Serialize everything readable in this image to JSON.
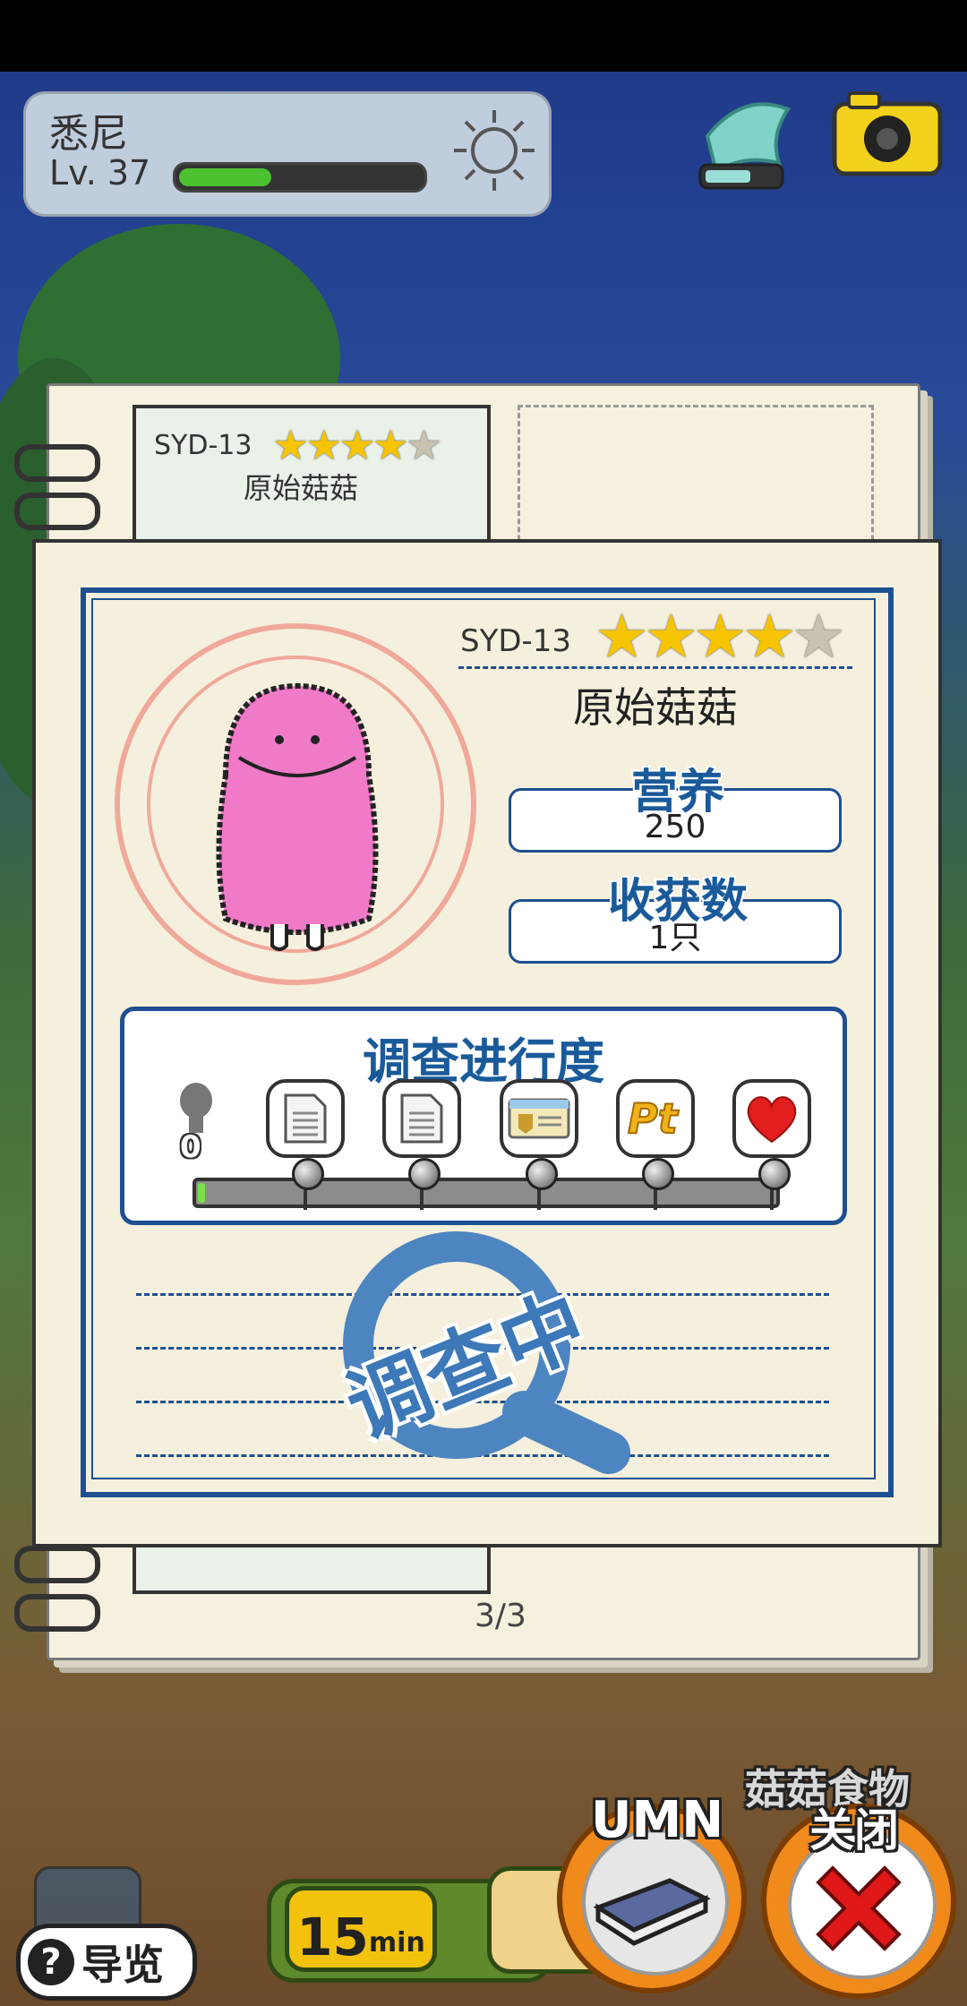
{
  "player": {
    "name": "悉尼",
    "level": "Lv. 37",
    "xp_fraction": 0.38
  },
  "book": {
    "page_indicator": "3/3",
    "left_card": {
      "code": "SYD-13",
      "name": "原始菇菇",
      "stars": 4,
      "max_stars": 5
    }
  },
  "detail": {
    "code": "SYD-13",
    "stars": 4,
    "max_stars": 5,
    "name": "原始菇菇",
    "nutrition_label": "营养",
    "nutrition_value": "250",
    "harvest_label": "收获数",
    "harvest_value": "1只",
    "progress_title": "调查进行度",
    "progress_count": "0",
    "progress_fraction": 0.01,
    "milestones": [
      "document-icon",
      "document-icon",
      "id-card-icon",
      "pt-icon",
      "heart-icon"
    ],
    "stamp_text": "调查中"
  },
  "bottom": {
    "timer_value": "15",
    "timer_unit": "min",
    "mushroom_food_label": "菇菇食物",
    "umn_label": "UMN",
    "close_label": "关闭",
    "guide_label": "导览"
  },
  "colors": {
    "accent_blue": "#1d4f91",
    "progress_green": "#7be048",
    "close_red": "#e01818",
    "star_gold": "#f6c400"
  }
}
